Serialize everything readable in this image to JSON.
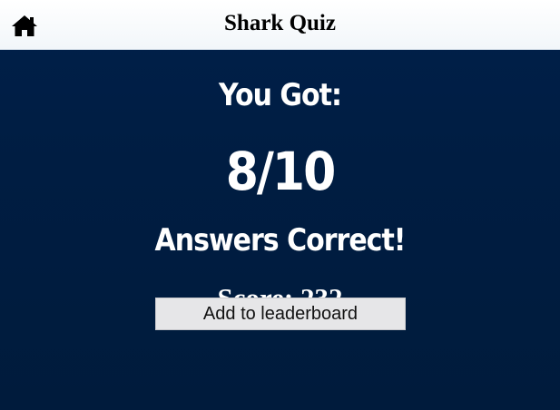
{
  "header": {
    "title": "Shark Quiz",
    "home_icon": "home-icon"
  },
  "result": {
    "intro": "You Got:",
    "fraction": "8/10",
    "correct_count": 8,
    "total_questions": 10,
    "suffix": "Answers Correct!",
    "score_text": "Score: 232"
  },
  "actions": {
    "leaderboard_label": "Add to leaderboard"
  },
  "colors": {
    "background": "#001f3f",
    "header_background": "#ffffff",
    "text": "#ffffff",
    "button_background": "#e6e6e8"
  }
}
